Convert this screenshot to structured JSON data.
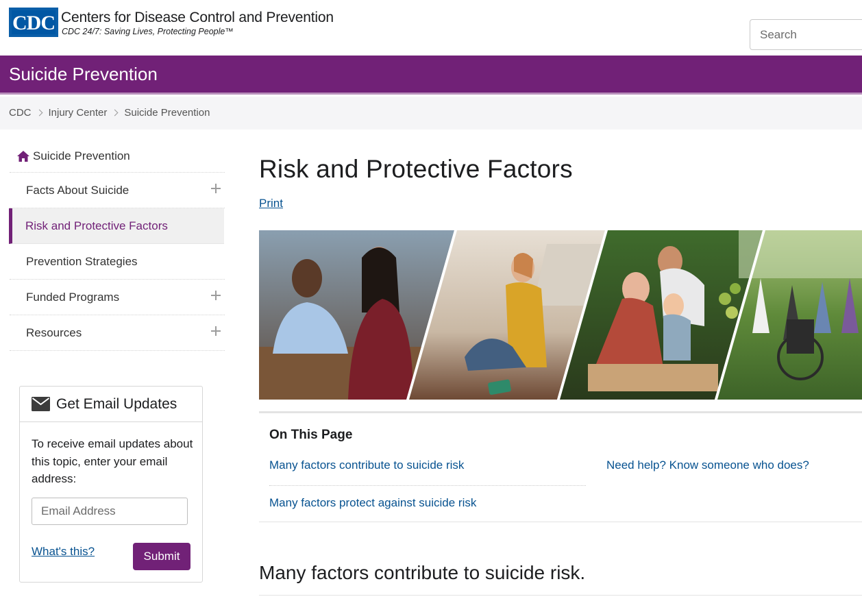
{
  "header": {
    "logo_text": "CDC",
    "org_name": "Centers for Disease Control and Prevention",
    "tagline": "CDC 24/7: Saving Lives, Protecting People™",
    "search_placeholder": "Search"
  },
  "topic": {
    "title": "Suicide Prevention"
  },
  "breadcrumb": [
    "CDC",
    "Injury Center",
    "Suicide Prevention"
  ],
  "left_nav": {
    "home_label": "Suicide Prevention",
    "home_icon": "home-icon",
    "items": [
      {
        "label": "Facts About Suicide",
        "expandable": true,
        "active": false
      },
      {
        "label": "Risk and Protective Factors",
        "expandable": false,
        "active": true
      },
      {
        "label": "Prevention Strategies",
        "expandable": false,
        "active": false
      },
      {
        "label": "Funded Programs",
        "expandable": true,
        "active": false
      },
      {
        "label": "Resources",
        "expandable": true,
        "active": false
      }
    ]
  },
  "email_updates": {
    "icon": "envelope-icon",
    "title": "Get Email Updates",
    "description": "To receive email updates about this topic, enter your email address:",
    "input_placeholder": "Email Address",
    "whats_this": "What's this?",
    "submit_label": "Submit"
  },
  "main": {
    "title": "Risk and Protective Factors",
    "print_label": "Print",
    "on_this_page": {
      "title": "On This Page",
      "links": [
        "Many factors contribute to suicide risk",
        "Many factors protect against suicide risk",
        "Need help? Know someone who does?"
      ]
    },
    "section_heading": "Many factors contribute to suicide risk."
  },
  "colors": {
    "brand_purple": "#712177",
    "link_blue": "#075290",
    "cdc_blue": "#0057a4"
  }
}
